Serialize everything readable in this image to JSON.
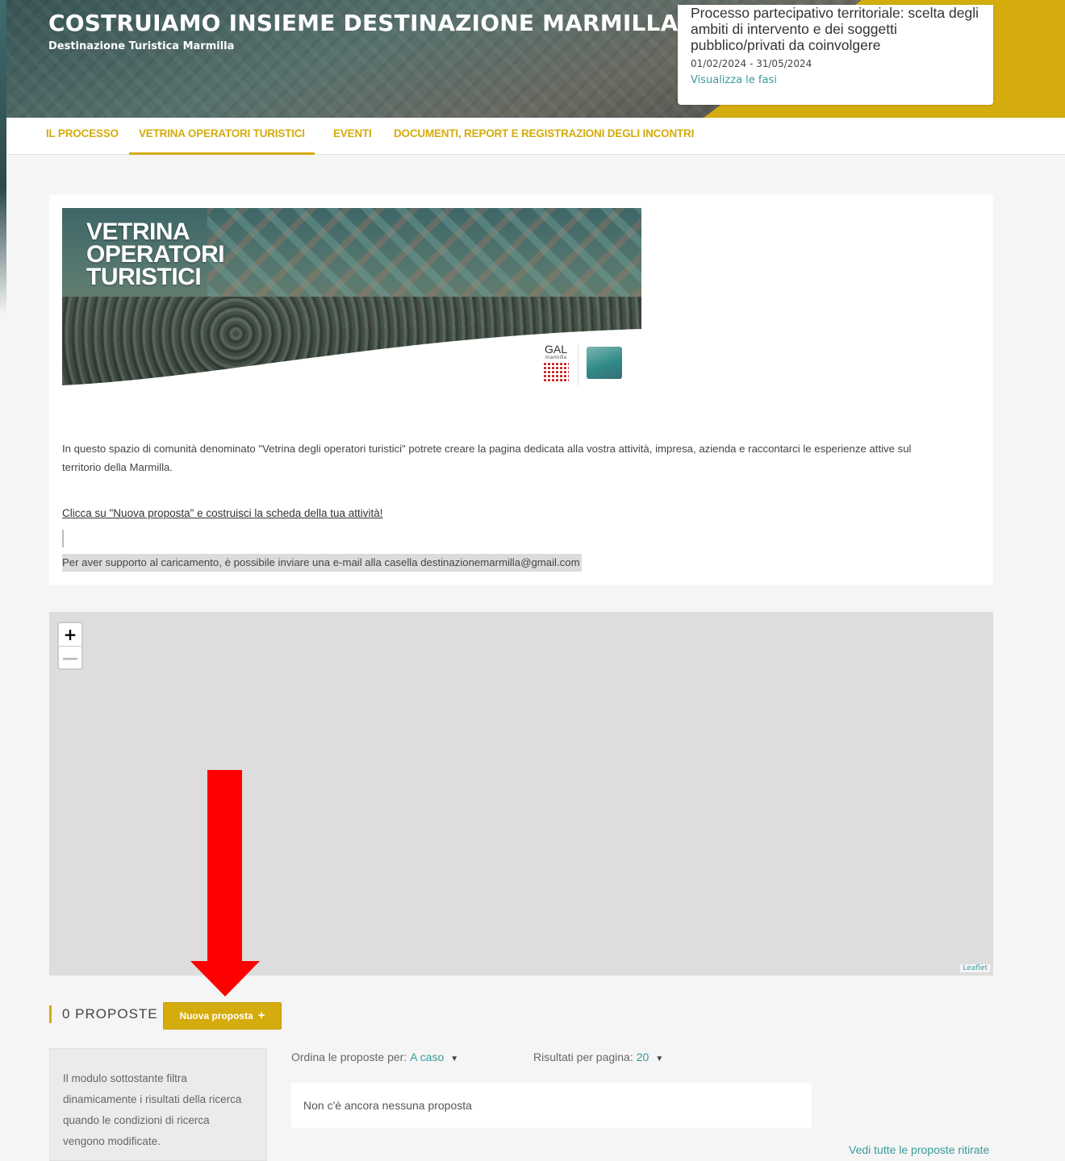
{
  "header": {
    "title": "COSTRUIAMO INSIEME DESTINAZIONE MARMILLA",
    "subtitle": "Destinazione Turistica Marmilla",
    "phase": {
      "title": "Processo partecipativo territoriale: scelta degli ambiti di intervento e dei soggetti pubblico/privati da coinvolgere",
      "dates": "01/02/2024 - 31/05/2024",
      "link": "Visualizza le fasi"
    }
  },
  "nav": {
    "items": [
      {
        "label": "IL PROCESSO",
        "active": false
      },
      {
        "label": "VETRINA OPERATORI TURISTICI",
        "active": true
      },
      {
        "label": "EVENTI",
        "active": false
      },
      {
        "label": "DOCUMENTI, REPORT E REGISTRAZIONI DEGLI INCONTRI",
        "active": false
      }
    ]
  },
  "banner": {
    "line1": "VETRINA",
    "line2": "OPERATORI",
    "line3": "TURISTICI",
    "logo_gal": "GAL",
    "logo_gal_sub": "marmilla"
  },
  "content": {
    "paragraph": "In questo spazio di comunità denominato \"Vetrina degli operatori turistici\" potrete creare la pagina dedicata alla vostra attività, impresa, azienda e raccontarci le esperienze attive sul territorio della Marmilla.",
    "cta": "Clicca su \"Nuova proposta\" e costruisci la scheda della tua attività!",
    "support": "Per aver supporto al caricamento, è possibile inviare una e-mail alla casella destinazionemarmilla@gmail.com"
  },
  "map": {
    "zoom_in": "+",
    "zoom_out": "—",
    "attribution": "Leaflet"
  },
  "proposals": {
    "count_label": "0 PROPOSTE",
    "new_button": "Nuova proposta",
    "new_button_icon": "+",
    "filter_text": "Il modulo sottostante filtra dinamicamente i risultati della ricerca quando le condizioni di ricerca vengono modificate.",
    "sort_label": "Ordina le proposte per:",
    "sort_value": "A caso",
    "per_page_label": "Risultati per pagina:",
    "per_page_value": "20",
    "empty": "Non c'è ancora nessuna proposta",
    "withdrawn_link": "Vedi tutte le proposte ritirate"
  },
  "colors": {
    "accent": "#d4ac0d",
    "link": "#3a9a9a",
    "annotation_arrow": "#ff0000"
  }
}
